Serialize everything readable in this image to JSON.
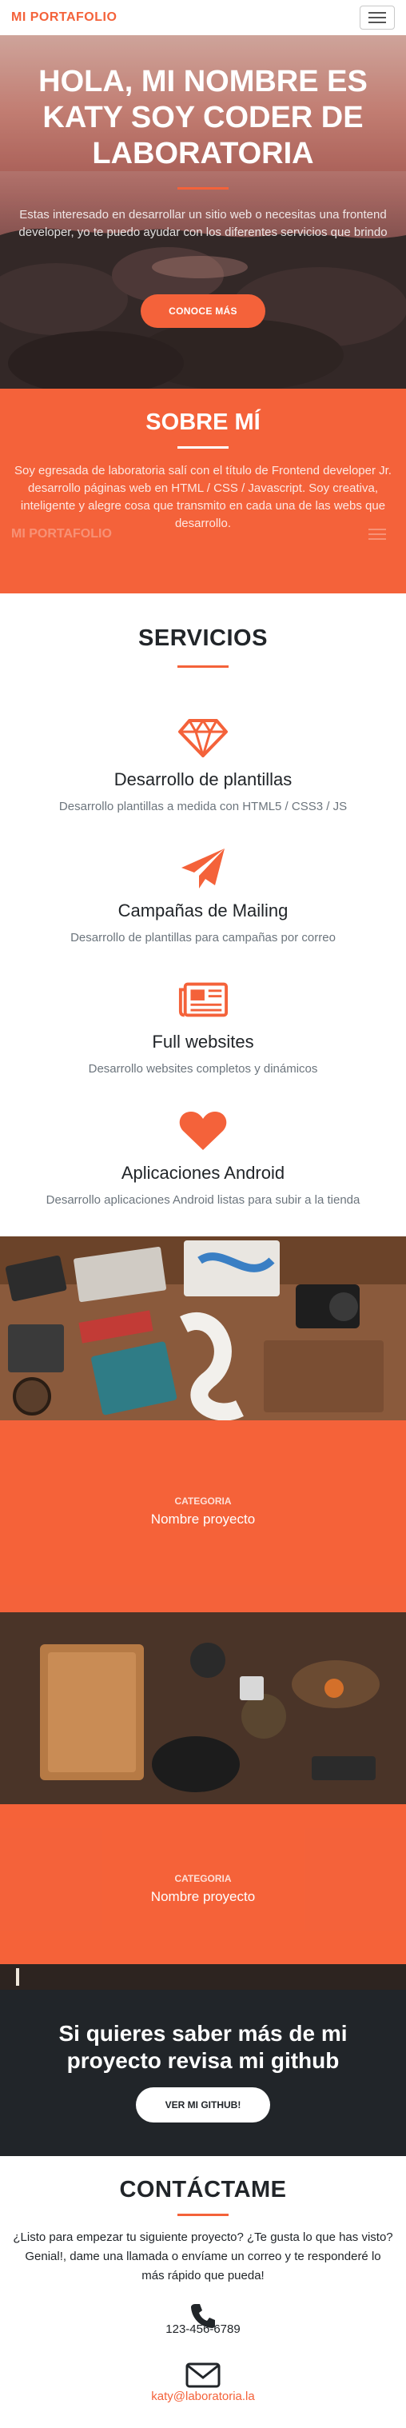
{
  "navbar": {
    "brand": "MI PORTAFOLIO"
  },
  "hero": {
    "title": "HOLA, MI NOMBRE ES KATY SOY CODER DE LABORATORIA",
    "text": "Estas interesado en desarrollar un sitio web o necesitas una frontend developer, yo te puedo ayudar con los diferentes servicios que brindo",
    "button_label": "CONOCE MÁS"
  },
  "about": {
    "title": "SOBRE MÍ",
    "text": "Soy egresada de laboratoria salí con el título de Frontend developer Jr. desarrollo páginas web en HTML / CSS / Javascript. Soy creativa, inteligente y alegre cosa que transmito en cada una de las webs que desarrollo.",
    "ghost_brand": "MI PORTAFOLIO"
  },
  "services": {
    "title": "SERVICIOS",
    "items": [
      {
        "icon": "diamond-icon",
        "title": "Desarrollo de plantillas",
        "text": "Desarrollo plantillas a medida con HTML5 / CSS3 / JS"
      },
      {
        "icon": "paper-plane-icon",
        "title": "Campañas de Mailing",
        "text": "Desarrollo de plantillas para campañas por correo"
      },
      {
        "icon": "newspaper-icon",
        "title": "Full websites",
        "text": "Desarrollo websites completos y dinámicos"
      },
      {
        "icon": "heart-icon",
        "title": "Aplicaciones Android",
        "text": "Desarrollo aplicaciones Android listas para subir a la tienda"
      }
    ]
  },
  "portfolio": {
    "items": [
      {
        "category": "CATEGORIA",
        "name": "Nombre proyecto"
      },
      {
        "category": "CATEGORIA",
        "name": "Nombre proyecto"
      }
    ]
  },
  "cta": {
    "title": "Si quieres saber más de mi proyecto revisa mi github",
    "button_label": "VER MI GITHUB!"
  },
  "contact": {
    "title": "CONTÁCTAME",
    "text": "¿Listo para empezar tu siguiente proyecto? ¿Te gusta lo que has visto? Genial!, dame una llamada o envíame un correo y te responderé lo más rápido que pueda!",
    "phone": "123-456-6789",
    "email": "katy@laboratoria.la"
  },
  "colors": {
    "accent": "#f4623a",
    "dark": "#212529",
    "muted": "#6c757d"
  }
}
